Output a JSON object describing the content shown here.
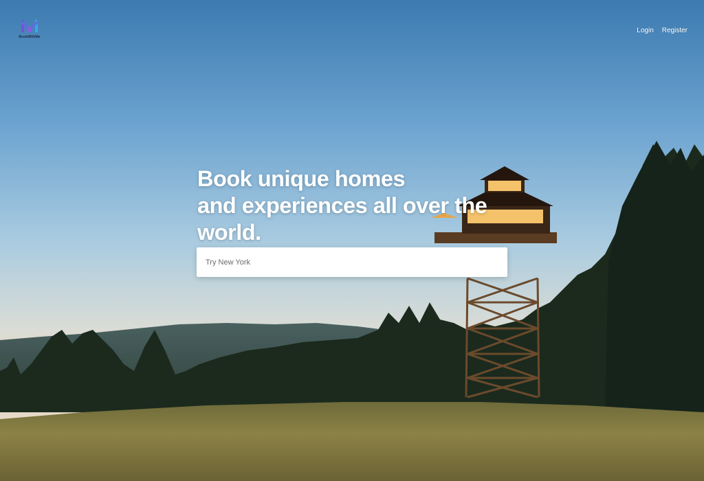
{
  "brand": {
    "name": "BookWithMe"
  },
  "nav": {
    "login_label": "Login",
    "register_label": "Register"
  },
  "hero": {
    "headline_lines": [
      "Book unique homes",
      "and experiences all over the",
      "world."
    ],
    "search_placeholder": "Try New York"
  },
  "colors": {
    "sky_top": "#3f7fb2",
    "sky_bottom": "#d8d6cf",
    "forest": "#1a2a1c",
    "meadow": "#8a7f45",
    "logo_purple": "#7a4fd6",
    "logo_blue": "#3aa6e8"
  }
}
